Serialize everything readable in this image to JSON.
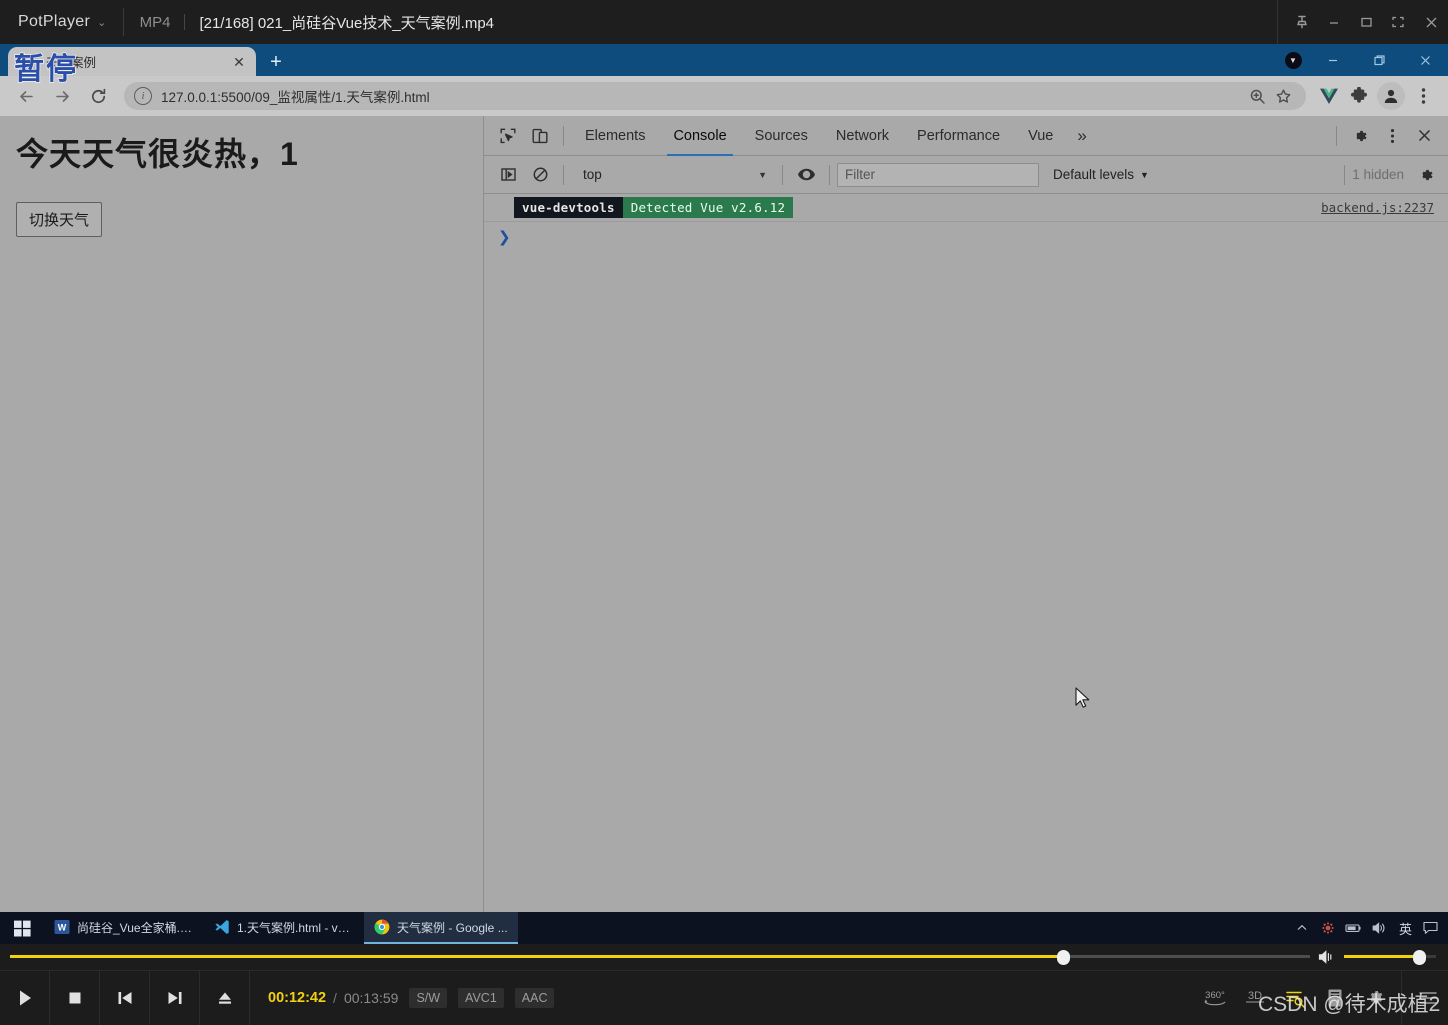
{
  "player": {
    "app_name": "PotPlayer",
    "format_badge": "MP4",
    "filename": "[21/168] 021_尚硅谷Vue技术_天气案例.mp4",
    "osd_status": "暂停",
    "window_buttons": [
      "pin",
      "minimize",
      "maximize",
      "fullscreen",
      "close"
    ],
    "time_current": "00:12:42",
    "time_separator": "/",
    "time_total": "00:13:59",
    "codec_badges": [
      "S/W",
      "AVC1",
      "AAC"
    ],
    "transport": [
      "play",
      "stop",
      "previous",
      "next",
      "eject"
    ],
    "right_tools": [
      "360",
      "3D",
      "playlist-search",
      "book",
      "settings",
      "menu"
    ],
    "label_360": "360°",
    "label_3d": "3D",
    "seek_percent": 81,
    "volume_percent": 82
  },
  "browser": {
    "tab": {
      "title": "天气案例",
      "close_label": "✕"
    },
    "new_tab_label": "+",
    "window_buttons": [
      "minimize",
      "restore",
      "close"
    ],
    "nav": {
      "back": "back-arrow",
      "forward": "forward-arrow",
      "reload": "reload"
    },
    "omnibox": {
      "info_glyph": "i",
      "url": "127.0.0.1:5500/09_监视属性/1.天气案例.html"
    },
    "toolbar_icons": [
      "zoom-in",
      "bookmark-star",
      "vue-devtools",
      "extensions",
      "profile",
      "chrome-menu"
    ]
  },
  "page": {
    "heading": "今天天气很炎热，1",
    "button_label": "切换天气"
  },
  "devtools": {
    "tabs": [
      {
        "label": "Elements",
        "selected": false
      },
      {
        "label": "Console",
        "selected": true
      },
      {
        "label": "Sources",
        "selected": false
      },
      {
        "label": "Network",
        "selected": false
      },
      {
        "label": "Performance",
        "selected": false
      },
      {
        "label": "Vue",
        "selected": false
      }
    ],
    "more_tabs_label": "»",
    "left_icons": [
      "inspect-element",
      "device-toolbar"
    ],
    "right_icons": [
      "settings-gear",
      "more-options",
      "close-devtools"
    ],
    "console_toolbar": {
      "sidebar_toggle": "console-sidebar",
      "clear_console": "clear-console",
      "context": "top",
      "context_caret": "▼",
      "live_expression": "eye-icon",
      "filter_placeholder": "Filter",
      "filter_value": "",
      "levels_label": "Default levels",
      "levels_caret": "▼",
      "hidden_label": "1 hidden",
      "settings": "console-settings-gear"
    },
    "messages": [
      {
        "badge_primary": "vue-devtools",
        "badge_secondary": "Detected Vue v2.6.12",
        "source": "backend.js:2237"
      }
    ],
    "prompt_caret": "❯"
  },
  "taskbar": {
    "start_label": "start",
    "items": [
      {
        "label": "尚硅谷_Vue全家桶.d...",
        "icon": "word-icon",
        "active": false
      },
      {
        "label": "1.天气案例.html - vu...",
        "icon": "vscode-icon",
        "active": false
      },
      {
        "label": "天气案例 - Google ...",
        "icon": "chrome-icon",
        "active": true
      }
    ],
    "tray": {
      "chevron": "▲",
      "icons": [
        "tray-app-icon",
        "battery-icon",
        "volume-icon",
        "notification-icon"
      ],
      "ime_label": "英"
    }
  },
  "watermark": "CSDN @待木成植2",
  "colors": {
    "potplayer_bg": "#1c1c1c",
    "potplayer_accent": "#f2d111",
    "chrome_tabstrip": "#0e4c7e",
    "page_bg": "#a9a9a9",
    "devtools_tab_underline": "#2b6fb5",
    "badge_dark": "#11161f",
    "badge_green": "#2a7a4e",
    "taskbar_bg": "#0c1220"
  }
}
